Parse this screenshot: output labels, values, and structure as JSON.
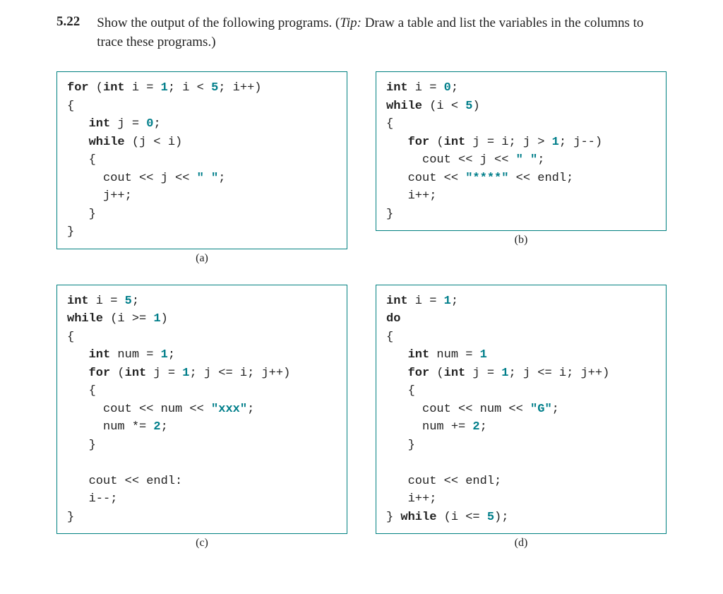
{
  "problem": {
    "number": "5.22",
    "text_before_tip": "Show the output of the following programs. (",
    "tip_label": "Tip:",
    "tip_text": " Draw a table and list the variables in the columns to trace these programs.)"
  },
  "boxes": {
    "a": {
      "caption": "(a)",
      "lines": [
        [
          {
            "t": "for",
            "c": "kw"
          },
          {
            "t": " ("
          },
          {
            "t": "int",
            "c": "kw"
          },
          {
            "t": " i = "
          },
          {
            "t": "1",
            "c": "num"
          },
          {
            "t": "; i < "
          },
          {
            "t": "5",
            "c": "num"
          },
          {
            "t": "; i++)"
          }
        ],
        [
          {
            "t": "{"
          }
        ],
        [
          {
            "t": "   "
          },
          {
            "t": "int",
            "c": "kw"
          },
          {
            "t": " j = "
          },
          {
            "t": "0",
            "c": "num"
          },
          {
            "t": ";"
          }
        ],
        [
          {
            "t": "   "
          },
          {
            "t": "while",
            "c": "kw"
          },
          {
            "t": " (j < i)"
          }
        ],
        [
          {
            "t": "   {"
          }
        ],
        [
          {
            "t": "     cout << j << "
          },
          {
            "t": "\" \"",
            "c": "str"
          },
          {
            "t": ";"
          }
        ],
        [
          {
            "t": "     j++;"
          }
        ],
        [
          {
            "t": "   }"
          }
        ],
        [
          {
            "t": "}"
          }
        ]
      ]
    },
    "b": {
      "caption": "(b)",
      "lines": [
        [
          {
            "t": "int",
            "c": "kw"
          },
          {
            "t": " i = "
          },
          {
            "t": "0",
            "c": "num"
          },
          {
            "t": ";"
          }
        ],
        [
          {
            "t": "while",
            "c": "kw"
          },
          {
            "t": " (i < "
          },
          {
            "t": "5",
            "c": "num"
          },
          {
            "t": ")"
          }
        ],
        [
          {
            "t": "{"
          }
        ],
        [
          {
            "t": "   "
          },
          {
            "t": "for",
            "c": "kw"
          },
          {
            "t": " ("
          },
          {
            "t": "int",
            "c": "kw"
          },
          {
            "t": " j = i; j > "
          },
          {
            "t": "1",
            "c": "num"
          },
          {
            "t": "; j--)"
          }
        ],
        [
          {
            "t": "     cout << j << "
          },
          {
            "t": "\" \"",
            "c": "str"
          },
          {
            "t": ";"
          }
        ],
        [
          {
            "t": "   cout << "
          },
          {
            "t": "\"****\"",
            "c": "str"
          },
          {
            "t": " << endl;"
          }
        ],
        [
          {
            "t": "   i++;"
          }
        ],
        [
          {
            "t": "}"
          }
        ]
      ]
    },
    "c": {
      "caption": "(c)",
      "lines": [
        [
          {
            "t": "int",
            "c": "kw"
          },
          {
            "t": " i = "
          },
          {
            "t": "5",
            "c": "num"
          },
          {
            "t": ";"
          }
        ],
        [
          {
            "t": "while",
            "c": "kw"
          },
          {
            "t": " (i >= "
          },
          {
            "t": "1",
            "c": "num"
          },
          {
            "t": ")"
          }
        ],
        [
          {
            "t": "{"
          }
        ],
        [
          {
            "t": "   "
          },
          {
            "t": "int",
            "c": "kw"
          },
          {
            "t": " num = "
          },
          {
            "t": "1",
            "c": "num"
          },
          {
            "t": ";"
          }
        ],
        [
          {
            "t": "   "
          },
          {
            "t": "for",
            "c": "kw"
          },
          {
            "t": " ("
          },
          {
            "t": "int",
            "c": "kw"
          },
          {
            "t": " j = "
          },
          {
            "t": "1",
            "c": "num"
          },
          {
            "t": "; j <= i; j++)"
          }
        ],
        [
          {
            "t": "   {"
          }
        ],
        [
          {
            "t": "     cout << num << "
          },
          {
            "t": "\"xxx\"",
            "c": "str"
          },
          {
            "t": ";"
          }
        ],
        [
          {
            "t": "     num *= "
          },
          {
            "t": "2",
            "c": "num"
          },
          {
            "t": ";"
          }
        ],
        [
          {
            "t": "   }"
          }
        ],
        [
          {
            "t": ""
          }
        ],
        [
          {
            "t": "   cout << endl:"
          }
        ],
        [
          {
            "t": "   i--;"
          }
        ],
        [
          {
            "t": "}"
          }
        ]
      ]
    },
    "d": {
      "caption": "(d)",
      "lines": [
        [
          {
            "t": "int",
            "c": "kw"
          },
          {
            "t": " i = "
          },
          {
            "t": "1",
            "c": "num"
          },
          {
            "t": ";"
          }
        ],
        [
          {
            "t": "do",
            "c": "kw"
          }
        ],
        [
          {
            "t": "{"
          }
        ],
        [
          {
            "t": "   "
          },
          {
            "t": "int",
            "c": "kw"
          },
          {
            "t": " num = "
          },
          {
            "t": "1",
            "c": "num"
          }
        ],
        [
          {
            "t": "   "
          },
          {
            "t": "for",
            "c": "kw"
          },
          {
            "t": " ("
          },
          {
            "t": "int",
            "c": "kw"
          },
          {
            "t": " j = "
          },
          {
            "t": "1",
            "c": "num"
          },
          {
            "t": "; j <= i; j++)"
          }
        ],
        [
          {
            "t": "   {"
          }
        ],
        [
          {
            "t": "     cout << num << "
          },
          {
            "t": "\"G\"",
            "c": "str"
          },
          {
            "t": ";"
          }
        ],
        [
          {
            "t": "     num += "
          },
          {
            "t": "2",
            "c": "num"
          },
          {
            "t": ";"
          }
        ],
        [
          {
            "t": "   }"
          }
        ],
        [
          {
            "t": ""
          }
        ],
        [
          {
            "t": "   cout << endl;"
          }
        ],
        [
          {
            "t": "   i++;"
          }
        ],
        [
          {
            "t": "} "
          },
          {
            "t": "while",
            "c": "kw"
          },
          {
            "t": " (i <= "
          },
          {
            "t": "5",
            "c": "num"
          },
          {
            "t": ");"
          }
        ]
      ]
    }
  }
}
